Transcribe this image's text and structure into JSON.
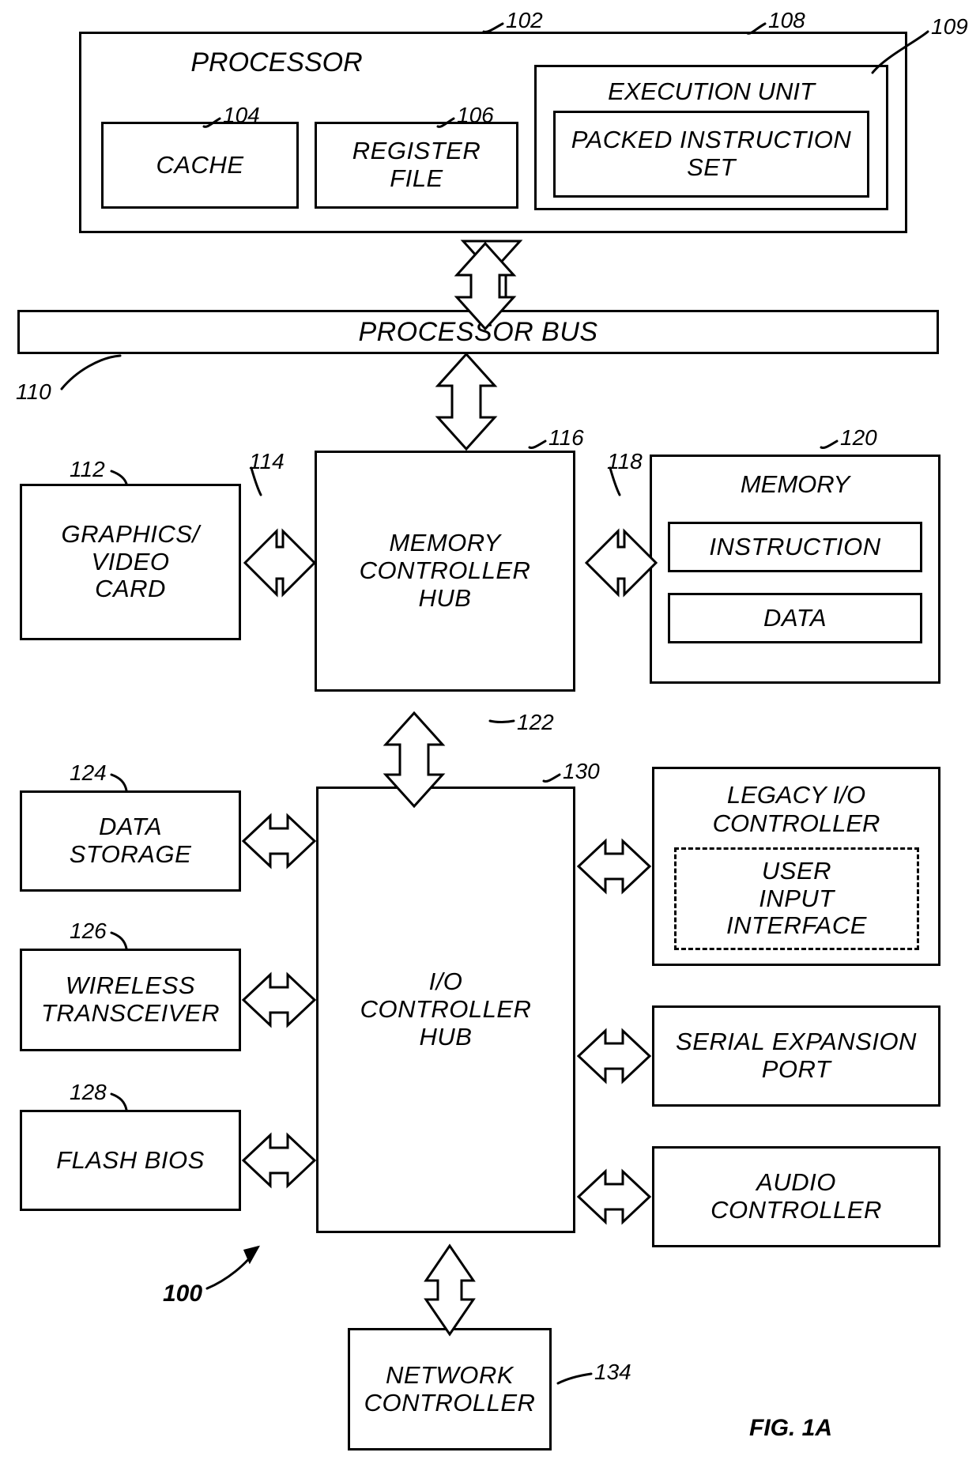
{
  "figure": {
    "caption": "FIG. 1A",
    "system_ref": "100"
  },
  "blocks": {
    "processor": {
      "label": "PROCESSOR",
      "ref": "102"
    },
    "cache": {
      "label": "CACHE",
      "ref": "104"
    },
    "register_file": {
      "label": "REGISTER\nFILE",
      "ref": "106"
    },
    "execution_unit": {
      "label": "EXECUTION UNIT",
      "ref": "108"
    },
    "packed_instruction_set": {
      "label": "PACKED INSTRUCTION\nSET",
      "ref": "109"
    },
    "processor_bus": {
      "label": "PROCESSOR BUS",
      "ref": "110"
    },
    "graphics_video_card": {
      "label": "GRAPHICS/\nVIDEO\nCARD",
      "ref": "112"
    },
    "graphics_link": {
      "ref": "114"
    },
    "memory_controller_hub": {
      "label": "MEMORY\nCONTROLLER\nHUB",
      "ref": "116"
    },
    "memory_link": {
      "ref": "118"
    },
    "memory": {
      "label": "MEMORY",
      "ref": "120"
    },
    "memory_instruction": {
      "label": "INSTRUCTION"
    },
    "memory_data": {
      "label": "DATA"
    },
    "hub_interface": {
      "ref": "122"
    },
    "data_storage": {
      "label": "DATA\nSTORAGE",
      "ref": "124"
    },
    "wireless_transceiver": {
      "label": "WIRELESS\nTRANSCEIVER",
      "ref": "126"
    },
    "flash_bios": {
      "label": "FLASH BIOS",
      "ref": "128"
    },
    "io_controller_hub": {
      "label": "I/O\nCONTROLLER\nHUB",
      "ref": "130"
    },
    "legacy_io_controller": {
      "label": "LEGACY I/O\nCONTROLLER"
    },
    "user_input_interface": {
      "label": "USER\nINPUT\nINTERFACE"
    },
    "serial_expansion_port": {
      "label": "SERIAL EXPANSION\nPORT"
    },
    "audio_controller": {
      "label": "AUDIO\nCONTROLLER"
    },
    "network_controller": {
      "label": "NETWORK\nCONTROLLER",
      "ref": "134"
    }
  }
}
